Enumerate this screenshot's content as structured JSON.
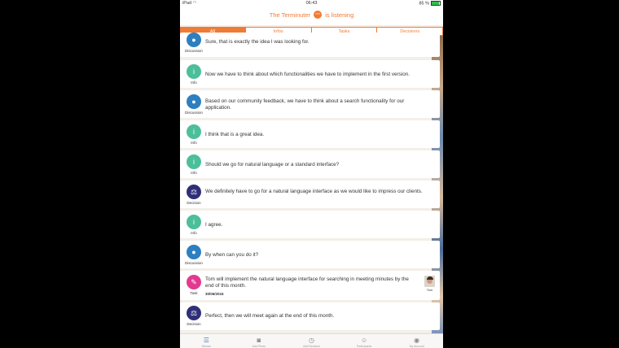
{
  "status_bar": {
    "device": "iPad",
    "wifi_icon": "wifi-icon",
    "time": "06:43",
    "battery": "85 %"
  },
  "header": {
    "title_prefix": "The Terminuter",
    "title_suffix": "is listening",
    "logo_icon": "owl-logo-icon"
  },
  "tabs": [
    {
      "label": "All",
      "active": true
    },
    {
      "label": "Infos",
      "active": false
    },
    {
      "label": "Tasks",
      "active": false
    },
    {
      "label": "Decisions",
      "active": false
    }
  ],
  "colors": {
    "accent": "#f07b35",
    "info": "#4cbf9a",
    "discussion": "#2d7fc0",
    "decision": "#2f2f78",
    "task": "#e23a8e"
  },
  "items": [
    {
      "type": "Discussion",
      "icon": "speech-bubble-icon",
      "text": "Sure, that is exactly the idea I was looking for."
    },
    {
      "type": "Info",
      "icon": "info-icon",
      "text": "Now we have to think about which functionalities we have to implement in the first version."
    },
    {
      "type": "Discussion",
      "icon": "speech-bubble-icon",
      "text": "Based on our community feedback, we have to think about a search functionality for our application."
    },
    {
      "type": "Info",
      "icon": "info-icon",
      "text": "I think that is a great idea."
    },
    {
      "type": "Info",
      "icon": "info-icon",
      "text": "Should we go for natural language or a standard interface?"
    },
    {
      "type": "Decision",
      "icon": "scales-icon",
      "text": "We definitely have to go for a natural language interface as we would like to impress our clients."
    },
    {
      "type": "Info",
      "icon": "info-icon",
      "text": "I agree."
    },
    {
      "type": "Discussion",
      "icon": "speech-bubble-icon",
      "text": "By when can you do it?"
    },
    {
      "type": "Task",
      "icon": "tools-icon",
      "text": "Tom will implement the natural language interface for searching in meeting minutes by the end of this month.",
      "date": "30/06/2016",
      "assignee": "Tom"
    },
    {
      "type": "Decision",
      "icon": "scales-icon",
      "text": "Perfect, then we will meet again at the end of this month."
    }
  ],
  "tab_bar": [
    {
      "label": "Stream",
      "icon": "list-icon"
    },
    {
      "label": "Add Photo",
      "icon": "camera-icon"
    },
    {
      "label": "Add Decision",
      "icon": "clock-icon"
    },
    {
      "label": "Participants",
      "icon": "person-icon"
    },
    {
      "label": "My Account",
      "icon": "account-icon"
    }
  ]
}
